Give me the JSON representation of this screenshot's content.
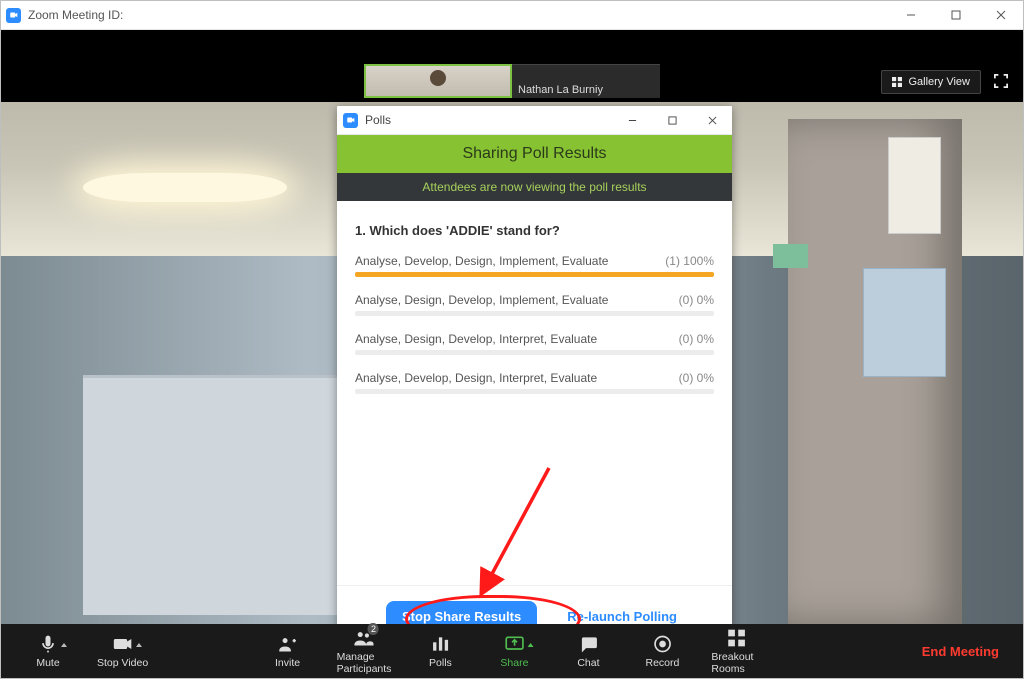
{
  "window": {
    "title_prefix": "Zoom Meeting ID:"
  },
  "thumbnails": {
    "second_name": "Nathan La Burniy"
  },
  "gallery": {
    "label": "Gallery View"
  },
  "polls": {
    "title": "Polls",
    "banner": "Sharing Poll Results",
    "subtext": "Attendees are now viewing the poll results",
    "question": "1. Which does 'ADDIE' stand for?",
    "options": [
      {
        "text": "Analyse, Develop, Design, Implement, Evaluate",
        "count": "(1)",
        "pct": "100%",
        "bar": 100
      },
      {
        "text": "Analyse, Design, Develop, Implement, Evaluate",
        "count": "(0)",
        "pct": "0%",
        "bar": 0
      },
      {
        "text": "Analyse, Design, Develop, Interpret, Evaluate",
        "count": "(0)",
        "pct": "0%",
        "bar": 0
      },
      {
        "text": "Analyse, Develop, Design, Interpret, Evaluate",
        "count": "(0)",
        "pct": "0%",
        "bar": 0
      }
    ],
    "stop_share": "Stop Share Results",
    "relaunch": "Re-launch Polling"
  },
  "controls": {
    "mute": "Mute",
    "stop_video": "Stop Video",
    "invite": "Invite",
    "manage": "Manage Participants",
    "manage_badge": "2",
    "polls": "Polls",
    "share": "Share",
    "chat": "Chat",
    "record": "Record",
    "breakout": "Breakout Rooms",
    "end": "End Meeting"
  }
}
